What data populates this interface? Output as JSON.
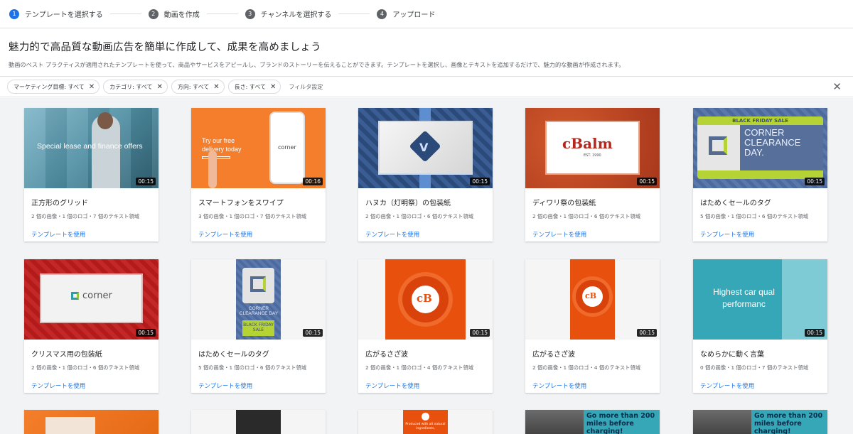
{
  "stepper": {
    "steps": [
      {
        "num": "1",
        "label": "テンプレートを選択する"
      },
      {
        "num": "2",
        "label": "動画を作成"
      },
      {
        "num": "3",
        "label": "チャンネルを選択する"
      },
      {
        "num": "4",
        "label": "アップロード"
      }
    ]
  },
  "intro": {
    "title": "魅力的で高品質な動画広告を簡単に作成して、成果を高めましょう",
    "description": "動画のベスト プラクティスが適用されたテンプレートを使って、商品やサービスをアピールし、ブランドのストーリーを伝えることができます。テンプレートを選択し、画像とテキストを追加するだけで、魅力的な動画が作成されます。"
  },
  "filters": {
    "chips": [
      "マーケティング目標: すべて",
      "カテゴリ: すべて",
      "方向: すべて",
      "長さ: すべて"
    ],
    "settings_label": "フィルタ設定",
    "close_icon": "close-icon"
  },
  "use_label": "テンプレートを使用",
  "cards": [
    {
      "title": "正方形のグリッド",
      "meta": "2 個の画像・1 個のロゴ・7 個のテキスト領域",
      "duration": "00:15",
      "thumb_text": "Special lease and finance offers"
    },
    {
      "title": "スマートフォンをスワイプ",
      "meta": "3 個の画像・1 個のロゴ・7 個のテキスト領域",
      "duration": "00:16",
      "thumb_text": "Try our free delivery today",
      "thumb_logo": "corner"
    },
    {
      "title": "ハヌカ（灯明祭）の包装紙",
      "meta": "2 個の画像・1 個のロゴ・6 個のテキスト領域",
      "duration": "00:15"
    },
    {
      "title": "ディワリ祭の包装紙",
      "meta": "2 個の画像・1 個のロゴ・6 個のテキスト領域",
      "duration": "00:15",
      "thumb_logo": "cBalm",
      "thumb_sub": "EST. 1990"
    },
    {
      "title": "はためくセールのタグ",
      "meta": "5 個の画像・1 個のロゴ・6 個のテキスト領域",
      "duration": "00:15",
      "thumb_banner": "BLACK FRIDAY SALE",
      "thumb_text": "CORNER CLEARANCE DAY."
    },
    {
      "title": "クリスマス用の包装紙",
      "meta": "2 個の画像・1 個のロゴ・6 個のテキスト領域",
      "duration": "00:15",
      "thumb_logo": "corner"
    },
    {
      "title": "はためくセールのタグ",
      "meta": "5 個の画像・1 個のロゴ・6 個のテキスト領域",
      "duration": "00:15",
      "thumb_text": "CORNER CLEARANCE DAY",
      "thumb_banner": "BLACK FRIDAY SALE"
    },
    {
      "title": "広がるさざ波",
      "meta": "2 個の画像・1 個のロゴ・4 個のテキスト領域",
      "duration": "00:15",
      "thumb_logo": "cB"
    },
    {
      "title": "広がるさざ波",
      "meta": "2 個の画像・1 個のロゴ・4 個のテキスト領域",
      "duration": "00:15",
      "thumb_logo": "cB"
    },
    {
      "title": "なめらかに動く言葉",
      "meta": "0 個の画像・1 個のロゴ・7 個のテキスト領域",
      "duration": "00:15",
      "thumb_text": "Highest car qual performanc"
    }
  ],
  "partial_row": {
    "texts": [
      "Go more than 200 miles before charging!",
      "Go more than 200 miles before charging!"
    ],
    "produced_text": "Produced with all natural ingredients,"
  },
  "colors": {
    "accent": "#1a73e8",
    "orange": "#f47e2b",
    "red_orange": "#e8500e",
    "teal": "#35a7b7",
    "green": "#b5d334"
  }
}
